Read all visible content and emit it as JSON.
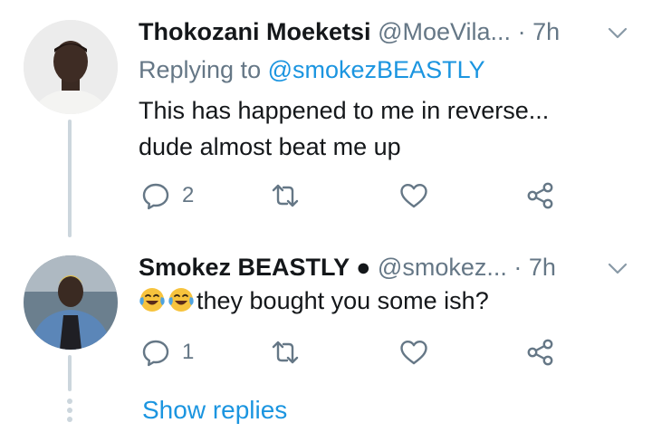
{
  "tweets": [
    {
      "display_name": "Thokozani Moeketsi",
      "handle": "@MoeVila...",
      "separator": "·",
      "time": "7h",
      "replying_prefix": "Replying to",
      "replying_to": "@smokezBEASTLY",
      "text_line1": "This has happened to me in reverse...",
      "text_line2": "dude almost beat me up",
      "reply_count": "2"
    },
    {
      "display_name": "Smokez BEASTLY ●",
      "handle": "@smokez...",
      "separator": "·",
      "time": "7h",
      "text": "they bought you some ish?",
      "emoji": [
        "face-with-tears-of-joy",
        "face-with-tears-of-joy"
      ],
      "reply_count": "1"
    }
  ],
  "show_replies": "Show replies",
  "colors": {
    "accent": "#1b95e0",
    "secondary": "#657786",
    "thread_line": "#ccd6dd"
  }
}
